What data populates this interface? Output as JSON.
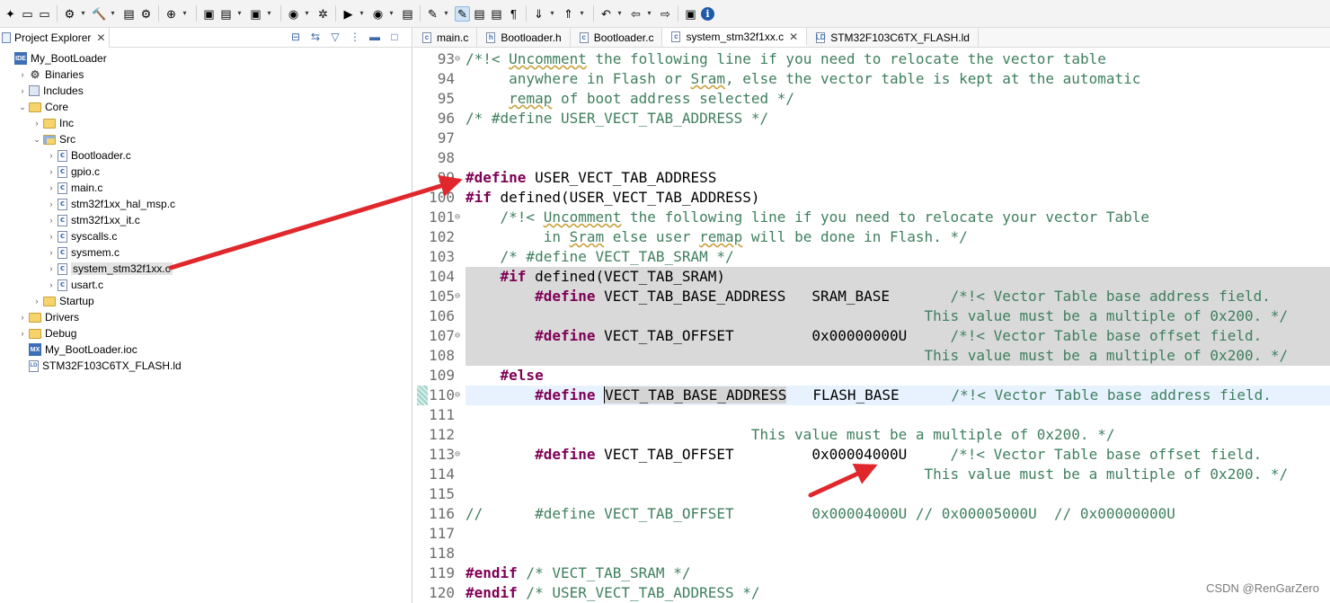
{
  "toolbar": {
    "buttons": [
      {
        "icon": "new-icon",
        "glyph": "✦"
      },
      {
        "icon": "save-icon",
        "glyph": "▭"
      },
      {
        "icon": "save-all-icon",
        "glyph": "▭"
      },
      {
        "icon": "settings-gear-icon",
        "glyph": "⚙"
      },
      {
        "icon": "build-hammer-icon",
        "glyph": "🔨"
      },
      {
        "icon": "binary-icon",
        "glyph": "▤"
      },
      {
        "icon": "debug-config-icon",
        "glyph": "⚙"
      },
      {
        "icon": "profile-icon",
        "glyph": "⊕"
      },
      {
        "icon": "new-project-icon",
        "glyph": "▣"
      },
      {
        "icon": "open-folder-icon",
        "glyph": "▤"
      },
      {
        "icon": "new-c-file-icon",
        "glyph": "▣"
      },
      {
        "icon": "run-config-icon",
        "glyph": "◉"
      },
      {
        "icon": "debug-bug-icon",
        "glyph": "✲"
      },
      {
        "icon": "run-play-icon",
        "glyph": "▶"
      },
      {
        "icon": "external-tools-icon",
        "glyph": "◉"
      },
      {
        "icon": "open-type-icon",
        "glyph": "▤"
      },
      {
        "icon": "search-icon",
        "glyph": "✎"
      },
      {
        "icon": "mark-occurrences-icon",
        "glyph": "✎"
      },
      {
        "icon": "toggle-highlight-icon",
        "glyph": "▤"
      },
      {
        "icon": "block-selection-icon",
        "glyph": "▤"
      },
      {
        "icon": "show-whitespace-icon",
        "glyph": "¶"
      },
      {
        "icon": "next-annotation-icon",
        "glyph": "⇓"
      },
      {
        "icon": "previous-annotation-icon",
        "glyph": "⇑"
      },
      {
        "icon": "last-edit-icon",
        "glyph": "↶"
      },
      {
        "icon": "back-icon",
        "glyph": "⇦"
      },
      {
        "icon": "forward-icon",
        "glyph": "⇨"
      },
      {
        "icon": "open-perspective-icon",
        "glyph": "▣"
      },
      {
        "icon": "info-icon",
        "glyph": "i"
      }
    ]
  },
  "explorer": {
    "title": "Project Explorer",
    "tree": [
      {
        "label": "My_BootLoader",
        "icon": "project-icon",
        "level": 0,
        "arrow": "",
        "badge": "IDE"
      },
      {
        "label": "Binaries",
        "icon": "binaries-icon",
        "level": 1,
        "arrow": "›"
      },
      {
        "label": "Includes",
        "icon": "includes-icon",
        "level": 1,
        "arrow": "›"
      },
      {
        "label": "Core",
        "icon": "folder-icon",
        "level": 1,
        "arrow": "⌄"
      },
      {
        "label": "Inc",
        "icon": "folder-icon",
        "level": 2,
        "arrow": "›"
      },
      {
        "label": "Src",
        "icon": "source-folder-icon",
        "level": 2,
        "arrow": "⌄"
      },
      {
        "label": "Bootloader.c",
        "icon": "c-file-icon",
        "level": 3,
        "arrow": "›"
      },
      {
        "label": "gpio.c",
        "icon": "c-file-icon",
        "level": 3,
        "arrow": "›"
      },
      {
        "label": "main.c",
        "icon": "c-file-icon",
        "level": 3,
        "arrow": "›"
      },
      {
        "label": "stm32f1xx_hal_msp.c",
        "icon": "c-file-icon",
        "level": 3,
        "arrow": "›"
      },
      {
        "label": "stm32f1xx_it.c",
        "icon": "c-file-icon",
        "level": 3,
        "arrow": "›"
      },
      {
        "label": "syscalls.c",
        "icon": "c-file-icon",
        "level": 3,
        "arrow": "›"
      },
      {
        "label": "sysmem.c",
        "icon": "c-file-icon",
        "level": 3,
        "arrow": "›"
      },
      {
        "label": "system_stm32f1xx.c",
        "icon": "c-file-icon",
        "level": 3,
        "arrow": "›",
        "selected": true
      },
      {
        "label": "usart.c",
        "icon": "c-file-icon",
        "level": 3,
        "arrow": "›"
      },
      {
        "label": "Startup",
        "icon": "folder-icon",
        "level": 2,
        "arrow": "›"
      },
      {
        "label": "Drivers",
        "icon": "folder-icon",
        "level": 1,
        "arrow": "›"
      },
      {
        "label": "Debug",
        "icon": "folder-icon",
        "level": 1,
        "arrow": "›"
      },
      {
        "label": "My_BootLoader.ioc",
        "icon": "mx-file-icon",
        "level": 1,
        "arrow": "",
        "badge": "MX"
      },
      {
        "label": "STM32F103C6TX_FLASH.ld",
        "icon": "linker-file-icon",
        "level": 1,
        "arrow": "",
        "badge": "LD"
      }
    ]
  },
  "editor": {
    "tabs": [
      {
        "label": "main.c",
        "badge": "c",
        "active": false,
        "closable": false
      },
      {
        "label": "Bootloader.h",
        "badge": "h",
        "active": false,
        "closable": false
      },
      {
        "label": "Bootloader.c",
        "badge": "c",
        "active": false,
        "closable": false
      },
      {
        "label": "system_stm32f1xx.c",
        "badge": "c",
        "active": true,
        "closable": true
      },
      {
        "label": "STM32F103C6TX_FLASH.ld",
        "badge": "LD",
        "active": false,
        "closable": false
      }
    ],
    "lines": [
      {
        "n": "93",
        "fold": "⊖",
        "segs": [
          {
            "t": "/*!< ",
            "c": "cm"
          },
          {
            "t": "Uncomment",
            "c": "cm sq"
          },
          {
            "t": " the following line if you need to relocate the vector table",
            "c": "cm"
          }
        ]
      },
      {
        "n": "94",
        "segs": [
          {
            "t": "     anywhere in Flash or ",
            "c": "cm"
          },
          {
            "t": "Sram",
            "c": "cm sq"
          },
          {
            "t": ", else the vector table is kept at the automatic",
            "c": "cm"
          }
        ]
      },
      {
        "n": "95",
        "segs": [
          {
            "t": "     ",
            "c": "cm"
          },
          {
            "t": "remap",
            "c": "cm sq"
          },
          {
            "t": " of boot address selected */",
            "c": "cm"
          }
        ]
      },
      {
        "n": "96",
        "segs": [
          {
            "t": "/* #define USER_VECT_TAB_ADDRESS */",
            "c": "cm"
          }
        ]
      },
      {
        "n": "97",
        "segs": []
      },
      {
        "n": "98",
        "segs": []
      },
      {
        "n": "99",
        "segs": [
          {
            "t": "#define",
            "c": "kw"
          },
          {
            "t": " USER_VECT_TAB_ADDRESS",
            "c": ""
          }
        ]
      },
      {
        "n": "100",
        "segs": [
          {
            "t": "#if",
            "c": "kw"
          },
          {
            "t": " defined(USER_VECT_TAB_ADDRESS)",
            "c": ""
          }
        ]
      },
      {
        "n": "101",
        "fold": "⊖",
        "segs": [
          {
            "t": "    /*!< ",
            "c": "cm"
          },
          {
            "t": "Uncomment",
            "c": "cm sq"
          },
          {
            "t": " the following line if you need to relocate your vector Table",
            "c": "cm"
          }
        ]
      },
      {
        "n": "102",
        "segs": [
          {
            "t": "         in ",
            "c": "cm"
          },
          {
            "t": "Sram",
            "c": "cm sq"
          },
          {
            "t": " else user ",
            "c": "cm"
          },
          {
            "t": "remap",
            "c": "cm sq"
          },
          {
            "t": " will be done in Flash. */",
            "c": "cm"
          }
        ]
      },
      {
        "n": "103",
        "segs": [
          {
            "t": "    /* #define VECT_TAB_SRAM */",
            "c": "cm"
          }
        ]
      },
      {
        "n": "104",
        "hl": "grey",
        "segs": [
          {
            "t": "    ",
            "c": ""
          },
          {
            "t": "#if",
            "c": "kw"
          },
          {
            "t": " defined(VECT_TAB_SRAM)",
            "c": ""
          }
        ]
      },
      {
        "n": "105",
        "fold": "⊖",
        "hl": "grey",
        "segs": [
          {
            "t": "        ",
            "c": ""
          },
          {
            "t": "#define",
            "c": "kw"
          },
          {
            "t": " VECT_TAB_BASE_ADDRESS   SRAM_BASE       ",
            "c": ""
          },
          {
            "t": "/*!< Vector Table base address field.",
            "c": "cm"
          }
        ]
      },
      {
        "n": "106",
        "hl": "grey",
        "segs": [
          {
            "t": "                                                     This value must be a multiple of 0x200. */",
            "c": "cm"
          }
        ]
      },
      {
        "n": "107",
        "fold": "⊖",
        "hl": "grey",
        "segs": [
          {
            "t": "        ",
            "c": ""
          },
          {
            "t": "#define",
            "c": "kw"
          },
          {
            "t": " VECT_TAB_OFFSET         0x00000000U     ",
            "c": ""
          },
          {
            "t": "/*!< Vector Table base offset field.",
            "c": "cm"
          }
        ]
      },
      {
        "n": "108",
        "hl": "grey",
        "segs": [
          {
            "t": "                                                     This value must be a multiple of 0x200. */",
            "c": "cm"
          }
        ]
      },
      {
        "n": "109",
        "segs": [
          {
            "t": "    ",
            "c": ""
          },
          {
            "t": "#else",
            "c": "kw"
          }
        ]
      },
      {
        "n": "110",
        "fold": "⊖",
        "hl": "cur",
        "marker": true,
        "segs": [
          {
            "t": "        ",
            "c": ""
          },
          {
            "t": "#define",
            "c": "kw"
          },
          {
            "t": " ",
            "c": ""
          },
          {
            "t": "VECT_TAB_BASE_ADDRESS",
            "c": "selword caret"
          },
          {
            "t": "   FLASH_BASE      ",
            "c": ""
          },
          {
            "t": "/*!< Vector Table base address field.",
            "c": "cm"
          }
        ]
      },
      {
        "n": "111",
        "segs": []
      },
      {
        "n": "112",
        "segs": [
          {
            "t": "                                 This value must be a multiple of 0x200. */",
            "c": "cm"
          }
        ]
      },
      {
        "n": "113",
        "fold": "⊖",
        "segs": [
          {
            "t": "        ",
            "c": ""
          },
          {
            "t": "#define",
            "c": "kw"
          },
          {
            "t": " VECT_TAB_OFFSET         0x00004000U     ",
            "c": ""
          },
          {
            "t": "/*!< Vector Table base offset field.",
            "c": "cm"
          }
        ]
      },
      {
        "n": "114",
        "segs": [
          {
            "t": "                                                     This value must be a multiple of 0x200. */",
            "c": "cm"
          }
        ]
      },
      {
        "n": "115",
        "segs": []
      },
      {
        "n": "116",
        "segs": [
          {
            "t": "//      #define VECT_TAB_OFFSET         0x00004000U // 0x00005000U  // 0x00000000U",
            "c": "cm"
          }
        ]
      },
      {
        "n": "117",
        "segs": []
      },
      {
        "n": "118",
        "segs": []
      },
      {
        "n": "119",
        "segs": [
          {
            "t": "#endif",
            "c": "kw"
          },
          {
            "t": " /* VECT_TAB_SRAM */",
            "c": "cm"
          }
        ]
      },
      {
        "n": "120",
        "segs": [
          {
            "t": "#endif",
            "c": "kw"
          },
          {
            "t": " /* USER_VECT_TAB_ADDRESS */",
            "c": "cm"
          }
        ]
      }
    ]
  },
  "annotations": {
    "arrow_color": "#e0282c",
    "arrows": [
      {
        "name": "arrow-to-define-line",
        "from": "system_stm32f1xx.c",
        "to": "#define USER_VECT_TAB_ADDRESS"
      },
      {
        "name": "arrow-to-offset-value",
        "to": "0x00004000U"
      }
    ]
  },
  "watermark": "CSDN @RenGarZero"
}
